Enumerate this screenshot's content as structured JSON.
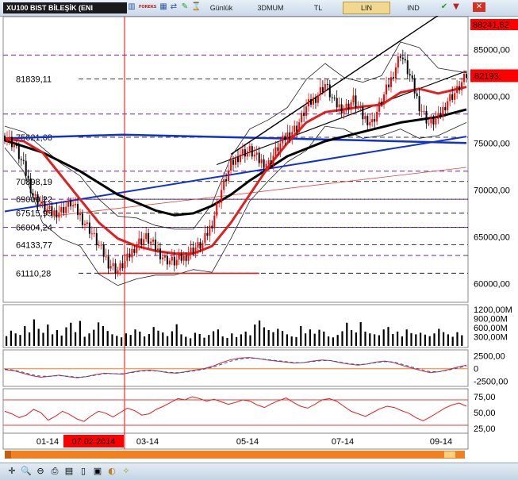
{
  "toolbar": {
    "symbol": "XU100 BIST  BİLEŞİK (ENI",
    "buttons": [
      "Günlük",
      "3DMUM",
      "TL",
      "LIN",
      "IND"
    ],
    "active_button": "LIN",
    "icons": [
      "chart-icon",
      "forex-logo-icon",
      "grid-icon",
      "compare-icon",
      "draw-icon",
      "period-icon",
      "check-icon",
      "down-arrow-icon",
      "close-icon"
    ]
  },
  "bottom_icons": [
    "crosshair-icon",
    "zoom-icon",
    "zoom-out-icon",
    "print-icon",
    "save-icon",
    "page-icon",
    "template-icon",
    "palette-icon",
    "magic-icon"
  ],
  "colors": {
    "up": "#ff0000",
    "down": "#000000",
    "ma_short": "#e02020",
    "ma_long": "#000000",
    "trend_blue": "#1030d0",
    "level_line": "#7020a0",
    "highlight": "#ff0000"
  },
  "chart_data": [
    {
      "type": "candlestick",
      "title": "XU100 BIST  BİLEŞİK (ENI",
      "x_ticks": [
        "01-14",
        "07.02.2014",
        "03-14",
        "05-14",
        "07-14",
        "09-14"
      ],
      "highlighted_x": "07.02.2014",
      "ylim": [
        58000,
        88500
      ],
      "y_ticks": [
        "85000,00",
        "80000,00",
        "75000,00",
        "70000,00",
        "65000,00",
        "60000,00"
      ],
      "last_price": "82193,",
      "high_price": "88241,82",
      "levels": [
        {
          "label": "81839,11",
          "value": 81839.11
        },
        {
          "label": "75621,68",
          "value": 75621.68
        },
        {
          "label": "70898,19",
          "value": 70898.19
        },
        {
          "label": "69000,22",
          "value": 69000.22
        },
        {
          "label": "67515,95",
          "value": 67515.95
        },
        {
          "label": "66004,24",
          "value": 66004.24
        },
        {
          "label": "64133,77",
          "value": 64133.77
        },
        {
          "label": "61110,28",
          "value": 61110.28
        }
      ],
      "close_path": [
        [
          0,
          75800
        ],
        [
          4,
          74800
        ],
        [
          8,
          72500
        ],
        [
          12,
          69500
        ],
        [
          16,
          68200
        ],
        [
          20,
          67500
        ],
        [
          24,
          67800
        ],
        [
          28,
          68600
        ],
        [
          32,
          67200
        ],
        [
          36,
          65800
        ],
        [
          40,
          64000
        ],
        [
          44,
          62200
        ],
        [
          48,
          61400
        ],
        [
          52,
          62600
        ],
        [
          56,
          64300
        ],
        [
          60,
          64900
        ],
        [
          64,
          63800
        ],
        [
          68,
          62600
        ],
        [
          72,
          62300
        ],
        [
          76,
          62800
        ],
        [
          80,
          63700
        ],
        [
          84,
          64200
        ],
        [
          88,
          66500
        ],
        [
          92,
          70000
        ],
        [
          96,
          72600
        ],
        [
          100,
          73900
        ],
        [
          104,
          74200
        ],
        [
          108,
          73100
        ],
        [
          112,
          72800
        ],
        [
          116,
          74500
        ],
        [
          120,
          75900
        ],
        [
          124,
          76700
        ],
        [
          128,
          78800
        ],
        [
          132,
          79900
        ],
        [
          136,
          81300
        ],
        [
          140,
          79200
        ],
        [
          144,
          78600
        ],
        [
          148,
          79600
        ],
        [
          152,
          77800
        ],
        [
          156,
          77200
        ],
        [
          160,
          79500
        ],
        [
          164,
          81800
        ],
        [
          168,
          84600
        ],
        [
          172,
          82100
        ],
        [
          176,
          79000
        ],
        [
          180,
          77100
        ],
        [
          184,
          77600
        ],
        [
          188,
          79600
        ],
        [
          192,
          80600
        ],
        [
          196,
          82200
        ]
      ],
      "ma_short_path": [
        [
          0,
          75500
        ],
        [
          8,
          75200
        ],
        [
          16,
          74000
        ],
        [
          24,
          71500
        ],
        [
          32,
          69000
        ],
        [
          40,
          66500
        ],
        [
          48,
          64800
        ],
        [
          56,
          64000
        ],
        [
          64,
          63500
        ],
        [
          72,
          63200
        ],
        [
          80,
          63200
        ],
        [
          88,
          64000
        ],
        [
          96,
          66500
        ],
        [
          104,
          69500
        ],
        [
          112,
          72500
        ],
        [
          120,
          75000
        ],
        [
          128,
          77200
        ],
        [
          136,
          78300
        ],
        [
          144,
          78600
        ],
        [
          152,
          78900
        ],
        [
          160,
          79100
        ],
        [
          168,
          80400
        ],
        [
          176,
          80800
        ],
        [
          184,
          80300
        ],
        [
          196,
          81000
        ]
      ],
      "ma_long_path": [
        [
          0,
          75300
        ],
        [
          16,
          74000
        ],
        [
          32,
          72000
        ],
        [
          48,
          69500
        ],
        [
          64,
          67800
        ],
        [
          72,
          67300
        ],
        [
          80,
          67500
        ],
        [
          88,
          68300
        ],
        [
          96,
          69500
        ],
        [
          104,
          71000
        ],
        [
          112,
          72300
        ],
        [
          120,
          73600
        ],
        [
          136,
          75200
        ],
        [
          152,
          76200
        ],
        [
          168,
          77200
        ],
        [
          184,
          77800
        ],
        [
          196,
          78600
        ]
      ],
      "trend_upper": [
        [
          96,
          73800
        ],
        [
          185,
          88800
        ]
      ],
      "trend_mid": [
        [
          90,
          72700
        ],
        [
          196,
          82700
        ]
      ],
      "trend_blue": [
        [
          0,
          67700
        ],
        [
          196,
          75700
        ]
      ],
      "trend_blue_flat": [
        [
          0,
          75500
        ],
        [
          50,
          75900
        ],
        [
          100,
          75600
        ],
        [
          150,
          75300
        ],
        [
          196,
          75000
        ]
      ],
      "trend_red_thin": [
        [
          20,
          67200
        ],
        [
          196,
          72400
        ]
      ],
      "support_line": [
        [
          40,
          61100
        ],
        [
          108,
          61100
        ]
      ],
      "bands_upper": [
        [
          0,
          76800
        ],
        [
          8,
          76200
        ],
        [
          16,
          74500
        ],
        [
          24,
          72800
        ],
        [
          32,
          71500
        ],
        [
          40,
          69000
        ],
        [
          48,
          67200
        ],
        [
          56,
          67000
        ],
        [
          64,
          66200
        ],
        [
          72,
          65800
        ],
        [
          80,
          65800
        ],
        [
          88,
          68500
        ],
        [
          96,
          73500
        ],
        [
          104,
          76500
        ],
        [
          112,
          77500
        ],
        [
          120,
          78800
        ],
        [
          128,
          81800
        ],
        [
          136,
          83500
        ],
        [
          144,
          82000
        ],
        [
          152,
          81500
        ],
        [
          160,
          82200
        ],
        [
          168,
          85800
        ],
        [
          176,
          85200
        ],
        [
          184,
          83000
        ],
        [
          196,
          82500
        ]
      ],
      "bands_lower": [
        [
          0,
          74500
        ],
        [
          8,
          72000
        ],
        [
          16,
          66500
        ],
        [
          24,
          64800
        ],
        [
          32,
          64000
        ],
        [
          40,
          61000
        ],
        [
          48,
          59800
        ],
        [
          56,
          60500
        ],
        [
          64,
          60900
        ],
        [
          72,
          60900
        ],
        [
          80,
          61500
        ],
        [
          88,
          61200
        ],
        [
          96,
          64800
        ],
        [
          104,
          68800
        ],
        [
          112,
          71000
        ],
        [
          120,
          73000
        ],
        [
          128,
          74200
        ],
        [
          136,
          76800
        ],
        [
          144,
          76500
        ],
        [
          152,
          75500
        ],
        [
          160,
          75800
        ],
        [
          168,
          76500
        ],
        [
          176,
          75500
        ],
        [
          184,
          75800
        ],
        [
          196,
          77200
        ]
      ]
    },
    {
      "type": "bar",
      "title": "",
      "y_ticks": [
        "1200,00M",
        "900,00M",
        "600,00M",
        "300,00M"
      ],
      "ylim": [
        0,
        1300
      ],
      "values": [
        320,
        500,
        410,
        360,
        650,
        440,
        870,
        560,
        430,
        700,
        380,
        520,
        340,
        610,
        760,
        450,
        820,
        300,
        410,
        530,
        770,
        650,
        490,
        380,
        330,
        280,
        410,
        360,
        540,
        470,
        310,
        390,
        620,
        500,
        440,
        320,
        480,
        710,
        380,
        300,
        250,
        430,
        390,
        270,
        360,
        480,
        540,
        310,
        260,
        410,
        290,
        380,
        470,
        350,
        700,
        830,
        610,
        520,
        450,
        560,
        490,
        380,
        310,
        290,
        650,
        410,
        540,
        400,
        530,
        470,
        310,
        280,
        360,
        480,
        760,
        520,
        440,
        780,
        470,
        410,
        380,
        350,
        540,
        620,
        390,
        470,
        310,
        540,
        420,
        380,
        430,
        370,
        320,
        410,
        560,
        450,
        380,
        300,
        450,
        350
      ]
    },
    {
      "type": "line",
      "title": "",
      "y_ticks": [
        "2500,00",
        "0",
        "-2500,00"
      ],
      "ylim": [
        -3200,
        3400
      ],
      "series": [
        {
          "color": "#e02020",
          "values": [
            -200,
            -400,
            -900,
            -1400,
            -1700,
            -1500,
            -1300,
            -1600,
            -1800,
            -1600,
            -1200,
            -900,
            -1000,
            -1100,
            -700,
            -400,
            -300,
            -500,
            -800,
            -900,
            -600,
            -300,
            0,
            500,
            1200,
            1800,
            2100,
            2200,
            2000,
            1700,
            1500,
            1300,
            1100,
            1200,
            1500,
            1700,
            1600,
            1200,
            900,
            700,
            900,
            1300,
            1500,
            1200,
            600,
            100,
            -400,
            -800,
            -600,
            -200,
            300,
            700
          ]
        },
        {
          "color": "#1060d0",
          "dashed": true,
          "values": [
            -100,
            -300,
            -700,
            -1200,
            -1500,
            -1500,
            -1400,
            -1500,
            -1700,
            -1600,
            -1300,
            -1000,
            -1000,
            -1000,
            -800,
            -500,
            -400,
            -500,
            -700,
            -800,
            -700,
            -400,
            -100,
            300,
            900,
            1500,
            1900,
            2100,
            2000,
            1800,
            1600,
            1400,
            1200,
            1200,
            1400,
            1600,
            1600,
            1300,
            1000,
            800,
            900,
            1200,
            1400,
            1300,
            800,
            300,
            -200,
            -600,
            -600,
            -300,
            100,
            500
          ]
        }
      ]
    },
    {
      "type": "line",
      "title": "",
      "y_ticks": [
        "75,00",
        "50,00",
        "25,00"
      ],
      "ylim": [
        20,
        85
      ],
      "series": [
        {
          "color": "#e02020",
          "values": [
            52,
            48,
            42,
            46,
            55,
            50,
            38,
            44,
            52,
            47,
            40,
            36,
            45,
            52,
            49,
            43,
            50,
            57,
            53,
            46,
            48,
            55,
            60,
            66,
            72,
            70,
            75,
            72,
            68,
            71,
            67,
            63,
            66,
            70,
            68,
            62,
            58,
            64,
            69,
            73,
            66,
            60,
            57,
            63,
            70,
            72,
            68,
            60,
            52,
            48,
            44,
            50,
            56,
            60,
            58,
            53,
            49,
            42,
            37,
            43,
            50,
            57,
            62,
            65,
            60
          ]
        }
      ]
    }
  ]
}
